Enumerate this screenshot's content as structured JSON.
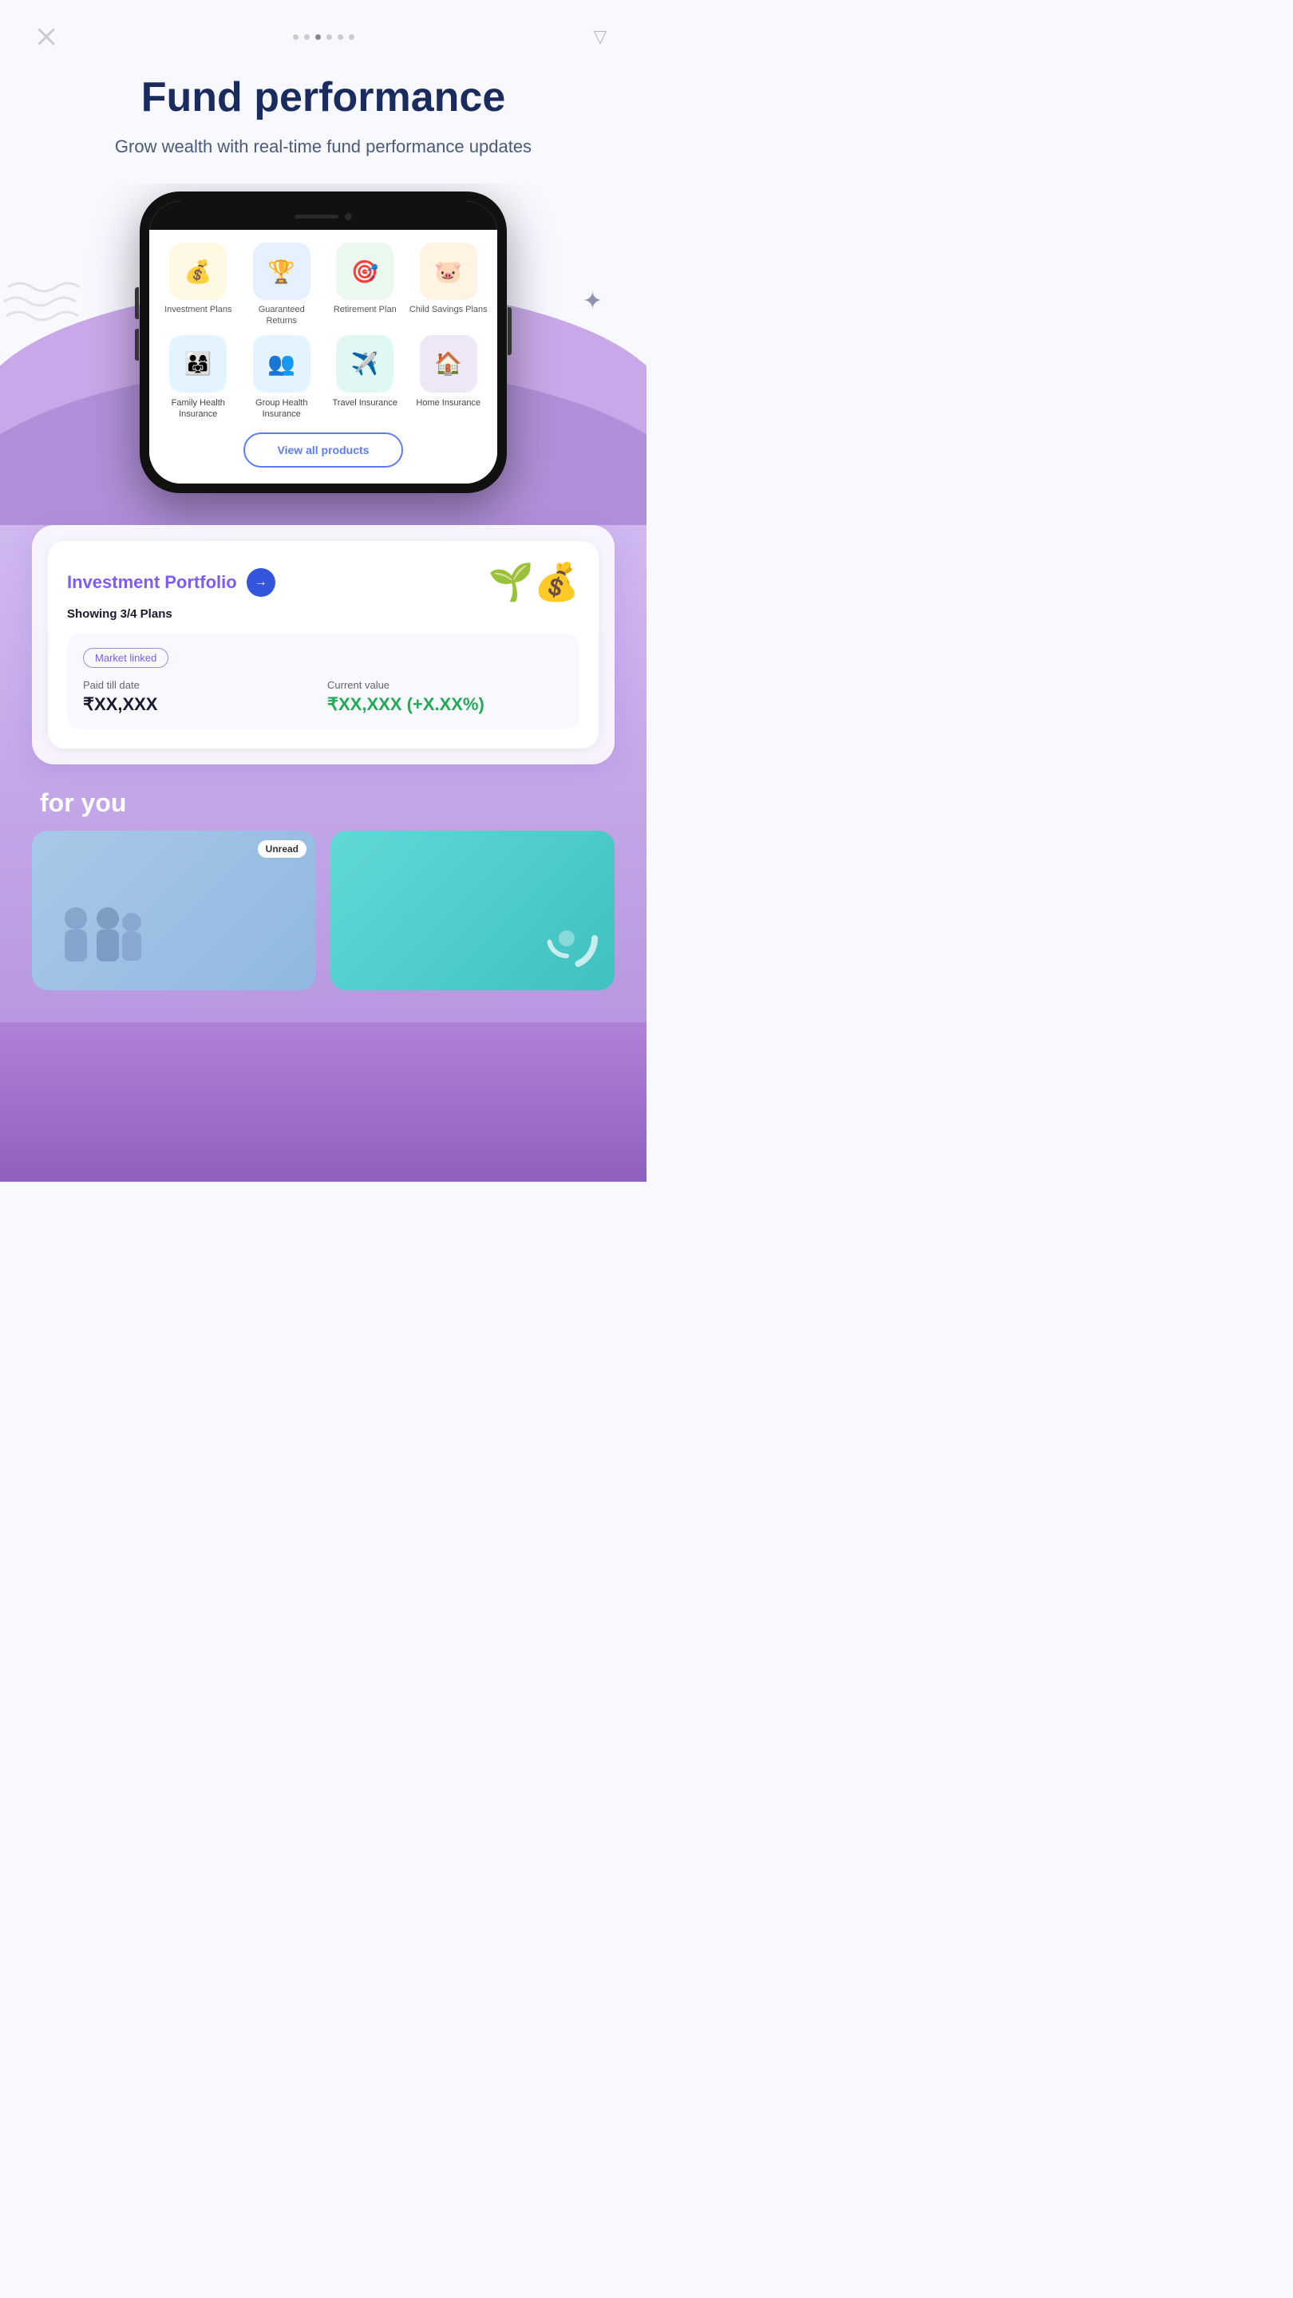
{
  "header": {
    "close_icon": "×",
    "triangle_icon": "▽"
  },
  "dots": [
    false,
    false,
    true,
    false,
    false,
    false
  ],
  "hero": {
    "title": "Fund performance",
    "subtitle": "Grow wealth with real-time fund performance updates"
  },
  "phone": {
    "top_products": [
      {
        "id": "investment-plans",
        "label": "Investment Plans",
        "emoji": "💰",
        "bg": "bg-yellow"
      },
      {
        "id": "guaranteed-returns",
        "label": "Guaranteed Returns",
        "emoji": "🏆",
        "bg": "bg-blue"
      },
      {
        "id": "retirement-plan",
        "label": "Retirement Plan",
        "emoji": "🎯",
        "bg": "bg-green"
      },
      {
        "id": "child-savings",
        "label": "Child Savings Plans",
        "emoji": "🐷",
        "bg": "bg-orange"
      }
    ],
    "insurance_products": [
      {
        "id": "family-health",
        "label": "Family Health Insurance",
        "emoji": "👨‍👩‍👧‍👦",
        "bg": "bg-lblue"
      },
      {
        "id": "group-health",
        "label": "Group Health Insurance",
        "emoji": "👥",
        "bg": "bg-lblue"
      },
      {
        "id": "travel",
        "label": "Travel Insurance",
        "emoji": "✈️",
        "bg": "bg-lblue"
      },
      {
        "id": "home",
        "label": "Home Insurance",
        "emoji": "🏠",
        "bg": "bg-purple"
      }
    ],
    "view_all_label": "View all products"
  },
  "portfolio": {
    "title": "Investment Portfolio",
    "subtitle": "Showing 3/4 Plans",
    "badge": "Market linked",
    "paid_label": "Paid till date",
    "paid_value": "₹XX,XXX",
    "current_label": "Current value",
    "current_value": "₹XX,XXX (+X.XX%)",
    "trend_icon": "↗"
  },
  "for_you": {
    "title": "for you",
    "card1_badge": "Unread",
    "card1_emoji": "🧑‍🤝‍🧑",
    "card2_emoji": "🌀"
  }
}
